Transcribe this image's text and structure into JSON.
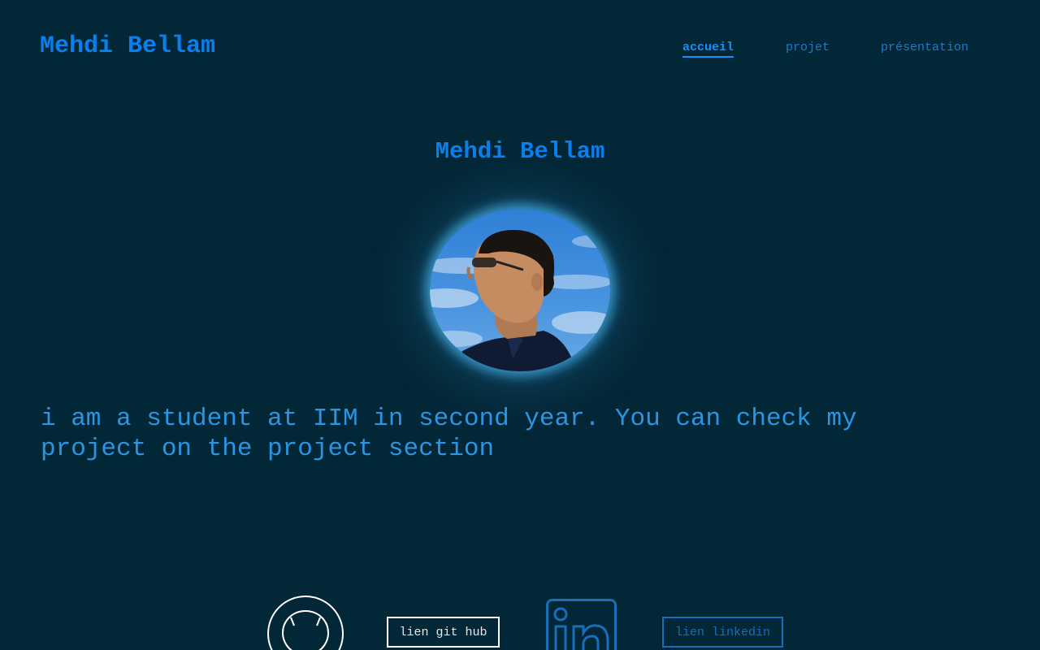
{
  "header": {
    "title": "Mehdi Bellam",
    "nav": [
      {
        "label": "accueil",
        "active": true
      },
      {
        "label": "projet",
        "active": false
      },
      {
        "label": "présentation",
        "active": false
      }
    ]
  },
  "hero": {
    "name": "Mehdi Bellam",
    "avatar_alt": "portrait photo",
    "bio": "i am a student at IIM in second year. You can check my project on the project section"
  },
  "links": {
    "github_icon": "github-icon",
    "github_label": "lien git hub",
    "linkedin_icon": "linkedin-icon",
    "linkedin_label": "lien linkedin"
  },
  "colors": {
    "background": "#022737",
    "accent": "#0a7fee",
    "text": "#2c94e0",
    "glow": "#46b4f0"
  }
}
